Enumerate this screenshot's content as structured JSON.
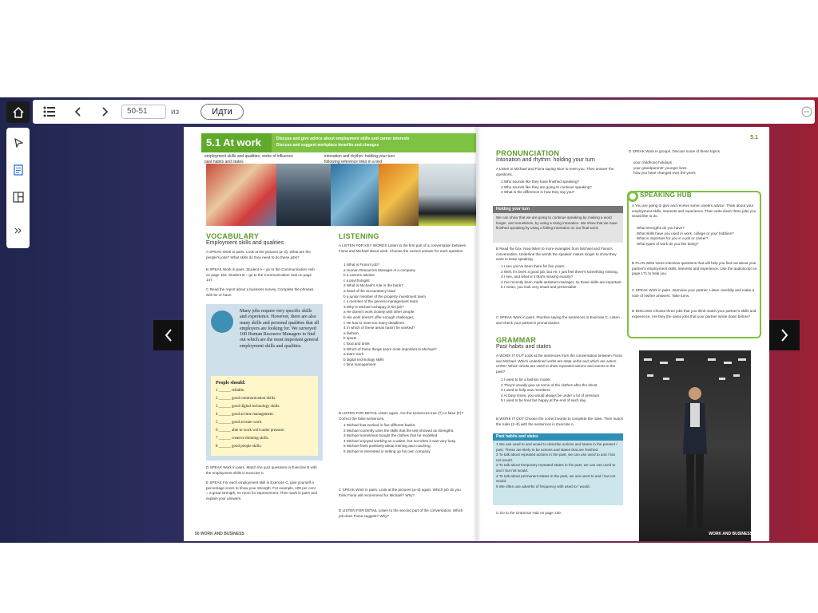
{
  "toolbar": {
    "page_value": "50-51",
    "of_label": "из",
    "go_label": "Идти"
  },
  "icons": {
    "home": "home-icon",
    "toc": "list-icon",
    "prev": "chevron-left-icon",
    "next": "chevron-right-icon",
    "pointer": "pointer-icon",
    "notes": "document-icon",
    "layout": "layout-icon",
    "expand": "double-chevron-icon",
    "menu": "ellipsis-icon"
  },
  "colors": {
    "accent_green": "#7ec242",
    "dark": "#1b1b1b",
    "blue": "#2f8fb6"
  },
  "book": {
    "left": {
      "unit_title": "5.1 At work",
      "unit_aims": [
        "Discuss and give advice about employment skills and career interests",
        "Discuss and suggest workplace benefits and changes"
      ],
      "sub_aims": [
        "employment skills and qualities; verbs of influence",
        "past habits and states",
        "intonation and rhythm: holding your turn",
        "following reference links in a text"
      ],
      "vocab_title": "VOCABULARY",
      "vocab_sub": "Employment skills and qualities",
      "vocab_a": "A SPEAK Work in pairs. Look at the pictures (a–d). What are the people's jobs? What skills do they need to do these jobs?",
      "vocab_b": "B SPEAK Work in pairs. Student A – go to the Communication Hub on page 152. Student B – go to the Communication Hub on page 147.",
      "vocab_c": "C Read the report about a business survey. Complete the phrases with be or have.",
      "report": "Many jobs require very specific skills and experience. However, there are also many skills and personal qualities that all employers are looking for. We surveyed 100 Human Resource Managers to find out which are the most important general employment skills and qualities.",
      "should_title": "People should:",
      "should_items": [
        "1 ______ reliable.",
        "2 ______ good communication skills.",
        "3 ______ good digital technology skills.",
        "4 ______ good at time management.",
        "5 ______ good at team work.",
        "6 ______ able to work well under pressure.",
        "7 ______ creative thinking skills.",
        "8 ______ good people skills."
      ],
      "vocab_d": "D SPEAK Work in pairs. Match the quiz questions in Exercise B with the employment skills in Exercise C.",
      "vocab_e": "E SPEAK For each employment skill in Exercise C, give yourself a percentage score to show your strength. For example, 100 per cent = a great strength, no room for improvement. Then work in pairs and explain your answers.",
      "listen_title": "LISTENING",
      "listen_a": "A LISTEN FOR KEY WORDS Listen to the first part of a conversation between Fiona and Michael about work. Choose the correct answer for each question.",
      "listen_q": [
        "1 What is Fiona's job?",
        "a Human Resources Manager in a company",
        "b a careers adviser",
        "c a psychologist",
        "2 What is Michael's role in the bank?",
        "a head of the accountancy team",
        "b a junior member of the property investment team",
        "c a member of the general management team",
        "3 Why is Michael unhappy in his job?",
        "a He doesn't work closely with other people.",
        "b His work doesn't offer enough challenges.",
        "c He has to meet too many deadlines.",
        "4 In which of these areas hasn't he worked?",
        "a fashion",
        "b sports",
        "c food and drink",
        "5 Which of these things seem most important to Michael?",
        "a team work",
        "b digital technology skills",
        "c time management"
      ],
      "listen_b": "B LISTEN FOR DETAIL Listen again. Are the sentences true (T) or false (F)? Correct the false sentences.",
      "listen_b_items": [
        "1 Michael has worked in five different banks.",
        "2 Michael currently uses the skills that the test showed as strengths.",
        "3 Michael sometimes bought the clothes that he modelled.",
        "4 Michael enjoyed working as a waiter, but not when it was very busy.",
        "5 Michael feels positively about training and coaching.",
        "6 Michael is interested in setting up his own company."
      ],
      "listen_c": "C SPEAK Work in pairs. Look at the pictures (a–d) again. Which job do you think Fiona will recommend for Michael? Why?",
      "listen_d": "D LISTEN FOR DETAIL Listen to the second part of the conversation. Which job does Fiona suggest? Why?",
      "footer": "50 WORK AND BUSINESS"
    },
    "right": {
      "unit_tag": "5.1",
      "pron_title": "PRONUNCIATION",
      "pron_sub": "Intonation and rhythm: holding your turn",
      "pron_a": "A Listen to Michael and Fiona saying Nice to meet you. Then answer the questions.",
      "pron_a_items": [
        "1 Who sounds like they have finished speaking?",
        "2 Who sounds like they are going to continue speaking?",
        "3 What is the difference in how they say you?"
      ],
      "hold_title": "Holding your turn",
      "hold_text": "We can show that we are going to continue speaking by making a word longer, and sometimes, by using a rising intonation. We show that we have finished speaking by using a falling intonation on our final word.",
      "pron_b": "B Read the box. Now listen to more examples from Michael and Fiona's conversation. Underline the words the speaker makes longer to show they want to keep speaking.",
      "pron_b_items": [
        "1 I see you've been there for five years.",
        "2 Well, it's been a good job, but err, I just feel there's something missing.",
        "3 I see, and what is it that's missing exactly?",
        "4 I've recently been made assistant manager, so those skills are important.",
        "5 I mean, you look very smart and presentable."
      ],
      "pron_c": "C SPEAK Work in pairs. Practise saying the sentences in Exercise C. Listen and check your partner's pronunciation.",
      "gram_title": "GRAMMAR",
      "gram_sub": "Past habits and states",
      "gram_a": "A WORK IT OUT Look at the sentences from the conversation between Fiona and Michael. Which underlined verbs are state verbs and which are action verbs? Which words are used to show repeated actions and events in the past?",
      "gram_a_items": [
        "1 I used to be a fashion model.",
        "2 They'd usually give us some of the clothes after the shoot.",
        "3 I used to help new members.",
        "4 At busy times, you would always be under a lot of pressure.",
        "5 I used to be tired but happy at the end of each day."
      ],
      "gram_b": "B WORK IT OUT Choose the correct words to complete the rules. Then match the rules (2–5) with the sentences in Exercise A.",
      "gram_box_title": "Past habits and states",
      "gram_box_items": [
        "1 We use used to and would to describe actions and states in the present / past. These are likely to be actions and states that are finished.",
        "2 To talk about repeated actions in the past, we can use used to and / but not would.",
        "3 To talk about temporary repeated states in the past, we can use used to and / but not would.",
        "4 To talk about permanent states in the past, we use used to and / but not would.",
        "5 We often use adverbs of frequency with used to / would."
      ],
      "gram_c": "C Go to the Grammar Hub on page 130.",
      "speak_d": "D SPEAK Work in groups. Discuss some of these topics.",
      "speak_d_items": [
        "your childhood holidays",
        "your grandparents' younger lives",
        "how you have changed over the years"
      ],
      "hub_title": "SPEAKING HUB",
      "hub_a": "A You are going to give and receive some careers advice. Think about your employment skills, interests and experience. Then write down three jobs you would like to do.",
      "hub_a_items": [
        "What strengths do you have?",
        "What skills have you used in work, college or your hobbies?",
        "What is important for you in a job or career?",
        "What types of work do you like doing?"
      ],
      "hub_b": "B PLAN Write some interview questions that will help you find out about your partner's employment skills, interests and experience. Use the audioscript on page 171 to help you.",
      "hub_c": "C SPEAK Work in pairs. Interview your partner. Listen carefully and make a note of his/her answers. Take turns.",
      "hub_d": "D DISCUSS Choose three jobs that you think match your partner's skills and experience. Are they the same jobs that your partner wrote down before?",
      "footer": "WORK AND BUSINESS 51"
    }
  }
}
